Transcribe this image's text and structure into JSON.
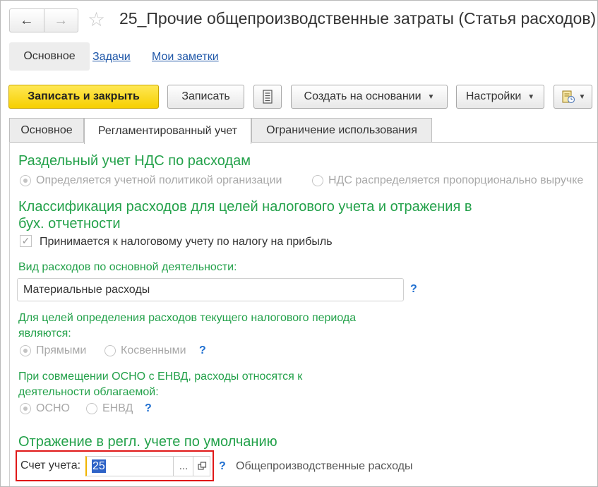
{
  "header": {
    "back_icon": "←",
    "forward_icon": "→",
    "star_icon": "☆",
    "title": "25_Прочие общепроизводственные затраты (Статья расходов)"
  },
  "sections": {
    "main": "Основное",
    "tasks": "Задачи",
    "notes": "Мои заметки"
  },
  "toolbar": {
    "save_close": "Записать и закрыть",
    "save": "Записать",
    "create_based": "Создать на основании",
    "settings": "Настройки"
  },
  "tabs": {
    "main": "Основное",
    "regulated": "Регламентированный учет",
    "restriction": "Ограничение использования"
  },
  "vat": {
    "heading": "Раздельный учет НДС по расходам",
    "option1": "Определяется учетной политикой организации",
    "option2": "НДС распределяется пропорционально выручке"
  },
  "classification": {
    "heading_line1": "Классификация расходов для целей налогового учета и отражения в",
    "heading_line2": "бух. отчетности",
    "checkbox_label": "Принимается к налоговому учету по налогу на прибыль",
    "checkbox_checked": true
  },
  "expense_type": {
    "label": "Вид расходов по основной деятельности:",
    "value": "Материальные расходы",
    "help": "?"
  },
  "period": {
    "label_line1": "Для целей определения расходов текущего налогового периода",
    "label_line2": "являются:",
    "option1": "Прямыми",
    "option2": "Косвенными",
    "help": "?"
  },
  "osno": {
    "label_line1": "При совмещении ОСНО с ЕНВД, расходы относятся к",
    "label_line2": "деятельности облагаемой:",
    "option1": "ОСНО",
    "option2": "ЕНВД",
    "help": "?"
  },
  "reflection": {
    "heading": "Отражение в регл. учете по умолчанию",
    "account_label": "Счет учета:",
    "account_value": "25",
    "dots": "...",
    "help": "?",
    "account_name": "Общепроизводственные расходы"
  },
  "colors": {
    "accent_green": "#23a14a",
    "primary_button": "#f6cf00",
    "link_blue": "#1f57a8",
    "highlight_red": "#e01818"
  }
}
